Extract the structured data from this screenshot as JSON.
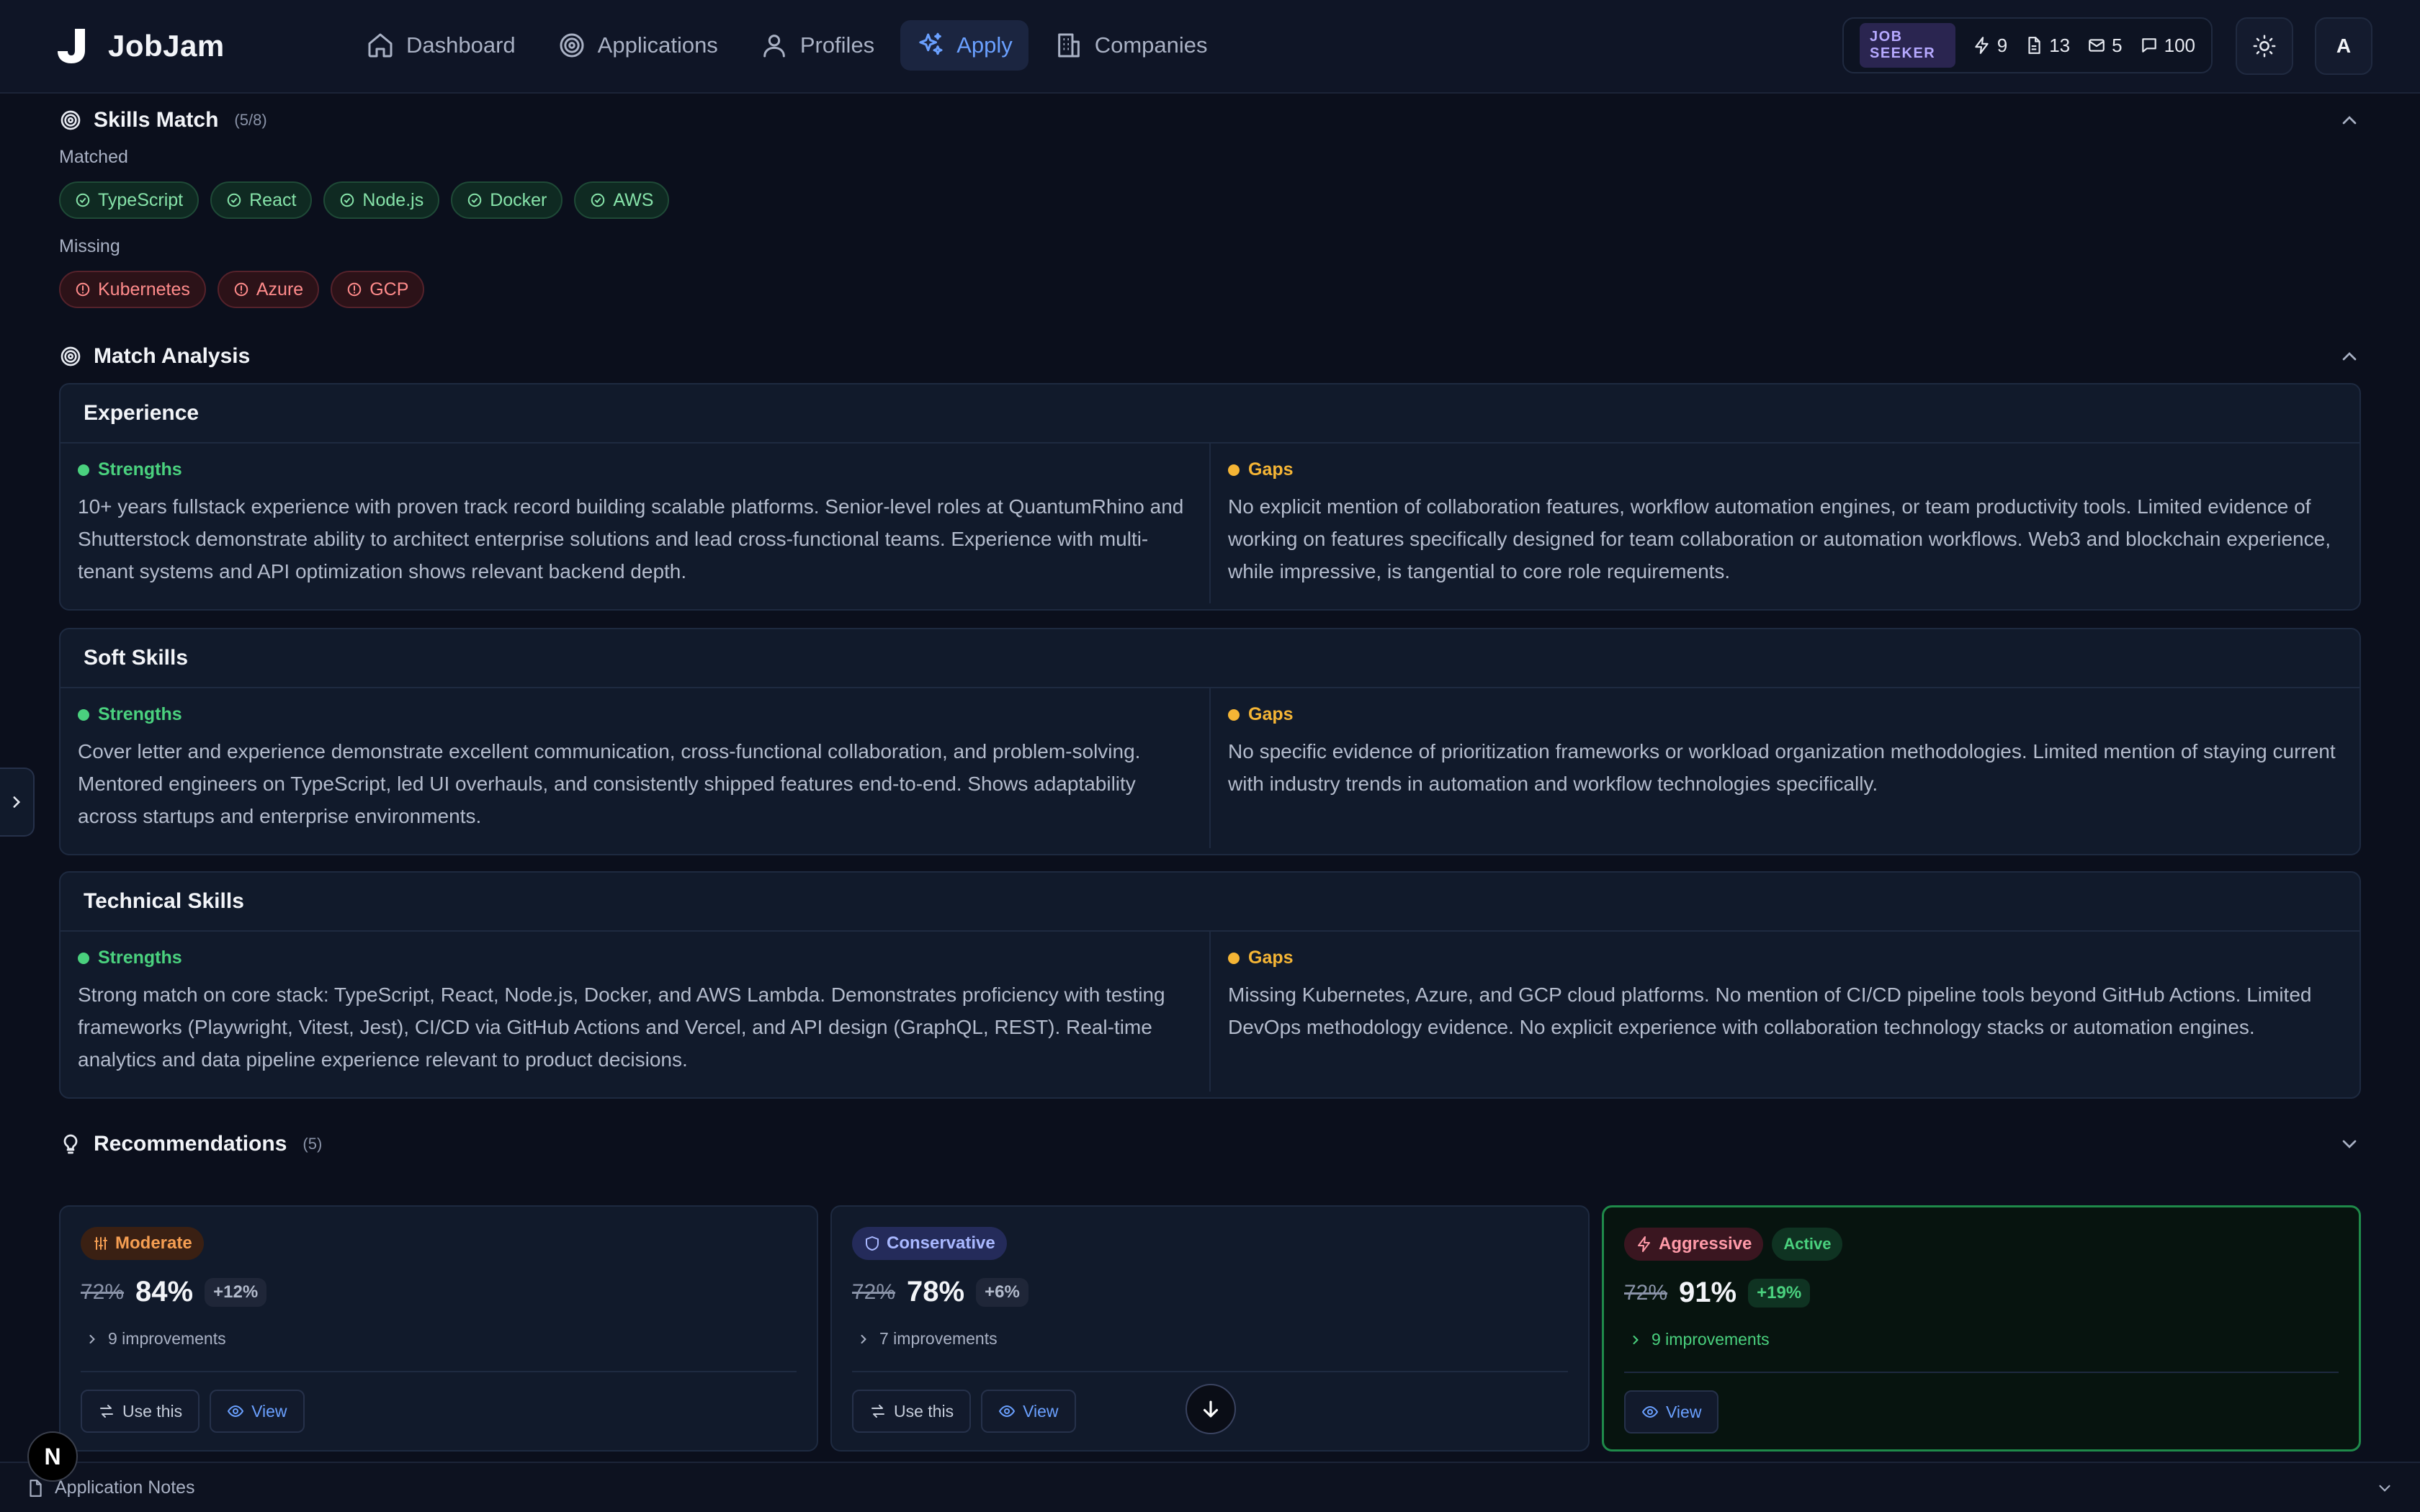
{
  "app": {
    "name": "JobJam"
  },
  "nav": [
    {
      "label": "Dashboard",
      "icon": "home-icon"
    },
    {
      "label": "Applications",
      "icon": "target-icon"
    },
    {
      "label": "Profiles",
      "icon": "user-icon"
    },
    {
      "label": "Apply",
      "icon": "sparkles-icon",
      "active": true
    },
    {
      "label": "Companies",
      "icon": "building-icon"
    }
  ],
  "stats": {
    "role": "JOB SEEKER",
    "bolts": "9",
    "docs": "13",
    "mail": "5",
    "messages": "100"
  },
  "user": {
    "avatar_initial": "A"
  },
  "skills_match": {
    "title": "Skills Match",
    "count": "(5/8)",
    "matched_label": "Matched",
    "matched": [
      "TypeScript",
      "React",
      "Node.js",
      "Docker",
      "AWS"
    ],
    "missing_label": "Missing",
    "missing": [
      "Kubernetes",
      "Azure",
      "GCP"
    ]
  },
  "match_analysis": {
    "title": "Match Analysis",
    "strengths_label": "Strengths",
    "gaps_label": "Gaps",
    "cards": [
      {
        "title": "Experience",
        "strengths": "10+ years fullstack experience with proven track record building scalable platforms. Senior-level roles at QuantumRhino and Shutterstock demonstrate ability to architect enterprise solutions and lead cross-functional teams. Experience with multi-tenant systems and API optimization shows relevant backend depth.",
        "gaps": "No explicit mention of collaboration features, workflow automation engines, or team productivity tools. Limited evidence of working on features specifically designed for team collaboration or automation workflows. Web3 and blockchain experience, while impressive, is tangential to core role requirements."
      },
      {
        "title": "Soft Skills",
        "strengths": "Cover letter and experience demonstrate excellent communication, cross-functional collaboration, and problem-solving. Mentored engineers on TypeScript, led UI overhauls, and consistently shipped features end-to-end. Shows adaptability across startups and enterprise environments.",
        "gaps": "No specific evidence of prioritization frameworks or workload organization methodologies. Limited mention of staying current with industry trends in automation and workflow technologies specifically."
      },
      {
        "title": "Technical Skills",
        "strengths": "Strong match on core stack: TypeScript, React, Node.js, Docker, and AWS Lambda. Demonstrates proficiency with testing frameworks (Playwright, Vitest, Jest), CI/CD via GitHub Actions and Vercel, and API design (GraphQL, REST). Real-time analytics and data pipeline experience relevant to product decisions.",
        "gaps": "Missing Kubernetes, Azure, and GCP cloud platforms. No mention of CI/CD pipeline tools beyond GitHub Actions. Limited DevOps methodology evidence. No explicit experience with collaboration technology stacks or automation engines."
      }
    ]
  },
  "recommendations": {
    "title": "Recommendations",
    "count": "(5)",
    "use_label": "Use this",
    "view_label": "View",
    "active_label": "Active",
    "items": [
      {
        "strategy": "Moderate",
        "old_score": "72%",
        "new_score": "84%",
        "delta": "+12%",
        "improvements": "9 improvements"
      },
      {
        "strategy": "Conservative",
        "old_score": "72%",
        "new_score": "78%",
        "delta": "+6%",
        "improvements": "7 improvements"
      },
      {
        "strategy": "Aggressive",
        "old_score": "72%",
        "new_score": "91%",
        "delta": "+19%",
        "improvements": "9 improvements",
        "active": true
      }
    ]
  },
  "notes": {
    "label": "Application Notes"
  },
  "dev_badge": "N",
  "colors": {
    "background": "#0b0f1c",
    "accent": "#6aa0ff",
    "success": "#4ad17e",
    "warning": "#f5b535",
    "danger": "#ff8b8b"
  }
}
